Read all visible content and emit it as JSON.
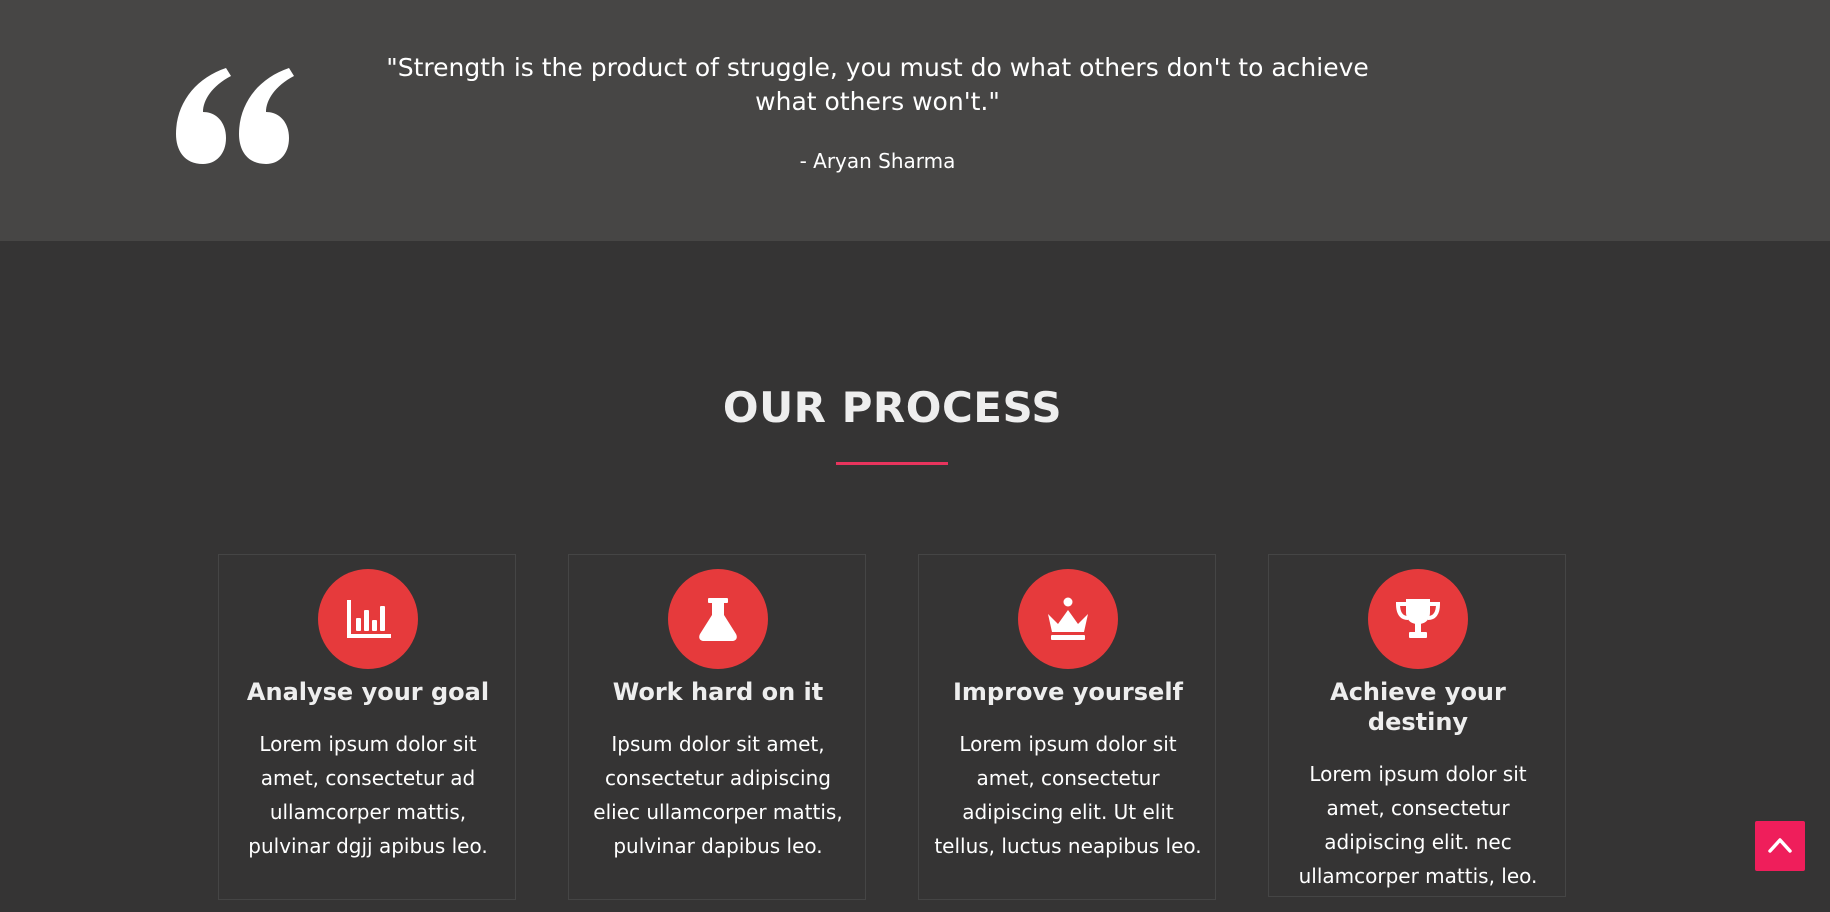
{
  "quote": {
    "text": "\"Strength is the product of struggle, you must do what others don't to achieve what others won't.\"",
    "author": "- Aryan Sharma",
    "icon": "quote-icon"
  },
  "process": {
    "title": "OUR PROCESS",
    "cards": [
      {
        "icon": "chart-icon",
        "title": "Analyse your goal",
        "text": "Lorem ipsum dolor sit amet, consectetur ad ullamcorper mattis, pulvinar dgjj apibus leo."
      },
      {
        "icon": "flask-icon",
        "title": "Work hard on it",
        "text": "Ipsum dolor sit amet, consectetur adipiscing eliec ullamcorper mattis, pulvinar dapibus leo."
      },
      {
        "icon": "crown-icon",
        "title": "Improve yourself",
        "text": "Lorem ipsum dolor sit amet, consectetur adipiscing elit. Ut elit tellus, luctus neapibus leo."
      },
      {
        "icon": "trophy-icon",
        "title": "Achieve your destiny",
        "text": "Lorem ipsum dolor sit amet, consectetur adipiscing elit. nec ullamcorper mattis, leo."
      }
    ]
  },
  "scroll_top": {
    "icon": "chevron-up-icon"
  },
  "colors": {
    "quote_background": "#474645",
    "page_background": "#353434",
    "accent_red": "#e63a3c",
    "underline_pink": "#e8345d",
    "scroll_button": "#ef1e5b"
  }
}
